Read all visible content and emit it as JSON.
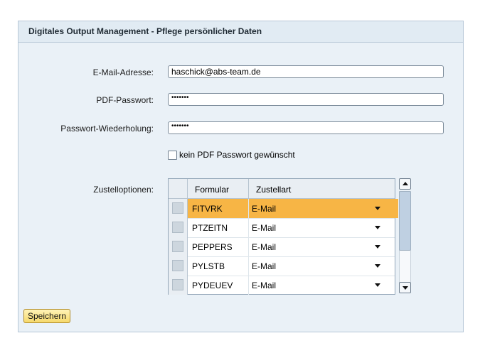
{
  "panel": {
    "title": "Digitales Output Management - Pflege persönlicher Daten"
  },
  "form": {
    "email_label": "E-Mail-Adresse:",
    "email_value": "haschick@abs-team.de",
    "pdf_password_label": "PDF-Passwort:",
    "pdf_password_value": "•••••••",
    "password_repeat_label": "Passwort-Wiederholung:",
    "password_repeat_value": "•••••••",
    "no_password_checkbox_label": "kein PDF Passwort gewünscht",
    "no_password_checked": false,
    "delivery_label": "Zustelloptionen:"
  },
  "table": {
    "columns": [
      "Formular",
      "Zustellart"
    ],
    "rows": [
      {
        "formular": "FITVRK",
        "zustellart": "E-Mail",
        "selected": true
      },
      {
        "formular": "PTZEITN",
        "zustellart": "E-Mail",
        "selected": false
      },
      {
        "formular": "PEPPERS",
        "zustellart": "E-Mail",
        "selected": false
      },
      {
        "formular": "PYLSTB",
        "zustellart": "E-Mail",
        "selected": false
      },
      {
        "formular": "PYDEUEV",
        "zustellart": "E-Mail",
        "selected": false
      }
    ]
  },
  "actions": {
    "save_label": "Speichern"
  },
  "colors": {
    "selected_row": "#f7b545",
    "panel_bg": "#eaf1f7",
    "save_button": "#f6d96b"
  }
}
